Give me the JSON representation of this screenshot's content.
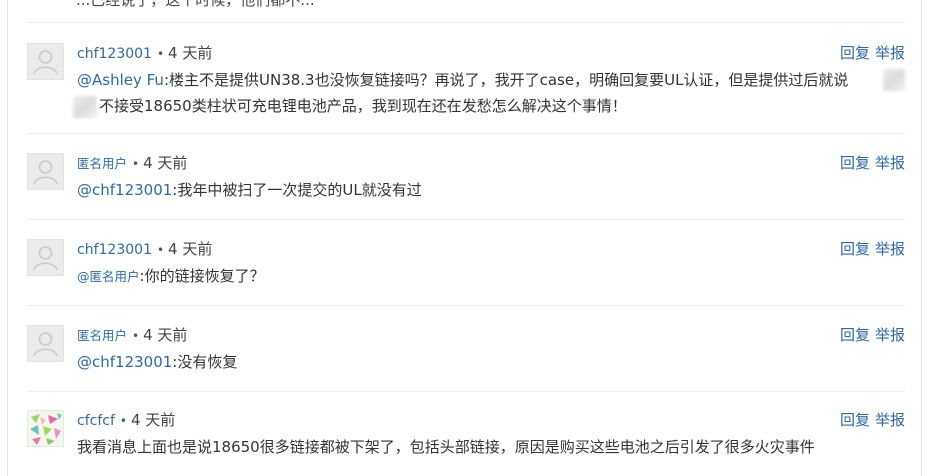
{
  "top_partial_text": "...已经说了，这个时候，他们都不...",
  "actions": {
    "reply": "回复",
    "report": "举报"
  },
  "comments": [
    {
      "user": "chf123001",
      "time": "4 天前",
      "mention": "@Ashley Fu",
      "text_line1": ":楼主不是提供UN38.3也没恢复链接吗？再说了，我开了case，明确回复要UL认证，但是提供过后就说",
      "text_line2": "不接受18650类柱状可充电锂电池产品，我到现在还在发愁怎么解决这个事情！",
      "avatar": "default-avatar-icon"
    },
    {
      "user": "匿名用户",
      "time": "4 天前",
      "mention": "@chf123001",
      "text": ":我年中被扫了一次提交的UL就没有过",
      "avatar": "default-avatar-icon"
    },
    {
      "user": "chf123001",
      "time": "4 天前",
      "mention": "@匿名用户",
      "text": ":你的链接恢复了？",
      "avatar": "default-avatar-icon"
    },
    {
      "user": "匿名用户",
      "time": "4 天前",
      "mention": "@chf123001",
      "text": ":没有恢复",
      "avatar": "default-avatar-icon"
    },
    {
      "user": "cfcfcf",
      "time": "4 天前",
      "text": "我看消息上面也是说18650很多链接都被下架了，包括头部链接，原因是购买这些电池之后引发了很多火灾事件",
      "avatar": "pattern-avatar-icon"
    }
  ]
}
